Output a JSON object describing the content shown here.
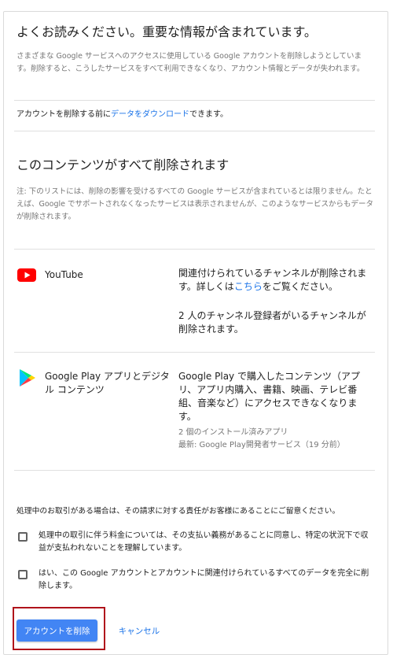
{
  "warning": {
    "title": "よくお読みください。重要な情報が含まれています。",
    "description": "さまざまな Google サービスへのアクセスに使用している Google アカウントを削除しようとしています。削除すると、こうしたサービスをすべて利用できなくなり、アカウント情報とデータが失われます。"
  },
  "download": {
    "prefix": "アカウントを削除する前に",
    "link": "データをダウンロード",
    "suffix": "できます。"
  },
  "content_section": {
    "title": "このコンテンツがすべて削除されます",
    "note": "注: 下のリストには、削除の影響を受けるすべての Google サービスが含まれているとは限りません。たとえば、Google でサポートされなくなったサービスは表示されませんが、このようなサービスからもデータが削除されます。"
  },
  "services": [
    {
      "icon": "youtube-icon",
      "name": "YouTube",
      "desc_prefix": "関連付けられているチャンネルが削除されます。詳しくは",
      "desc_link": "こちら",
      "desc_suffix": "をご覧ください。",
      "detail": "2 人のチャンネル登録者がいるチャンネルが削除されます。"
    },
    {
      "icon": "google-play-icon",
      "name": "Google Play アプリとデジタル コンテンツ",
      "desc": "Google Play で購入したコンテンツ（アプリ、アプリ内購入、書籍、映画、テレビ番組、音楽など）にアクセスできなくなります。",
      "meta1": "2 個のインストール済みアプリ",
      "meta2": "最新: Google Play開発者サービス（19 分前）"
    }
  ],
  "transactions_notice": "処理中のお取引がある場合は、その請求に対する責任がお客様にあることにご留意ください。",
  "checkboxes": [
    {
      "label": "処理中の取引に伴う料金については、その支払い義務があることに同意し、特定の状況下で収益が支払われないことを理解しています。",
      "checked": false
    },
    {
      "label": "はい、この Google アカウントとアカウントに関連付けられているすべてのデータを完全に削除します。",
      "checked": false
    }
  ],
  "actions": {
    "delete": "アカウントを削除",
    "cancel": "キャンセル"
  },
  "colors": {
    "primary": "#4285f4",
    "link": "#1a73e8",
    "youtube_red": "#ff0000",
    "highlight_border": "#b0141b"
  }
}
